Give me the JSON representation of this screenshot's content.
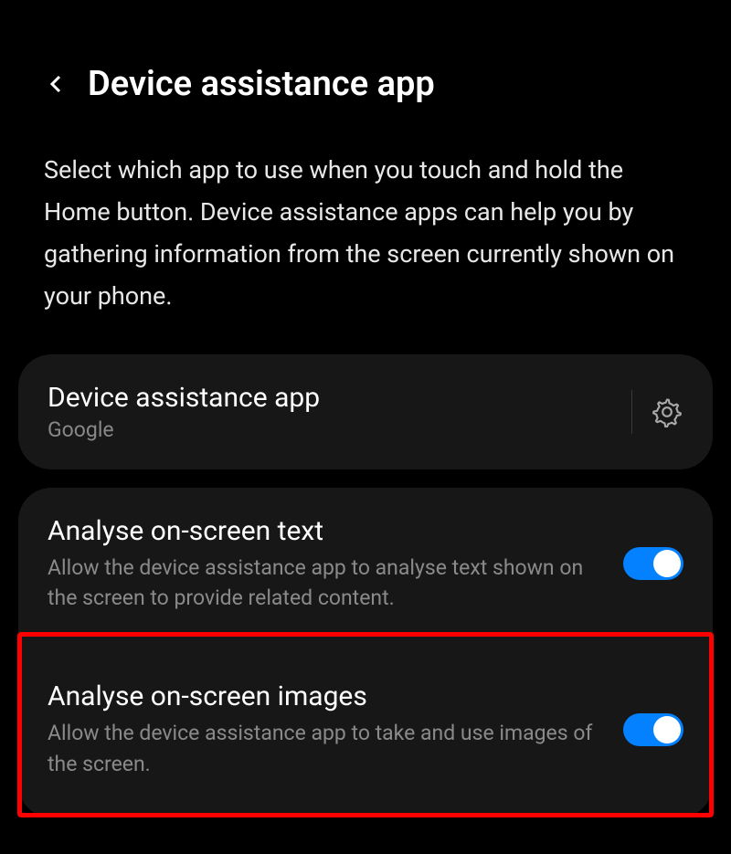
{
  "header": {
    "title": "Device assistance app"
  },
  "description": "Select which app to use when you touch and hold the Home button. Device assistance apps can help you by gathering information from the screen currently shown on your phone.",
  "appSelector": {
    "title": "Device assistance app",
    "value": "Google"
  },
  "settings": [
    {
      "title": "Analyse on-screen text",
      "description": "Allow the device assistance app to analyse text shown on the screen to provide related content.",
      "enabled": true
    },
    {
      "title": "Analyse on-screen images",
      "description": "Allow the device assistance app to take and use images of the screen.",
      "enabled": true
    }
  ],
  "highlightedIndex": 1
}
